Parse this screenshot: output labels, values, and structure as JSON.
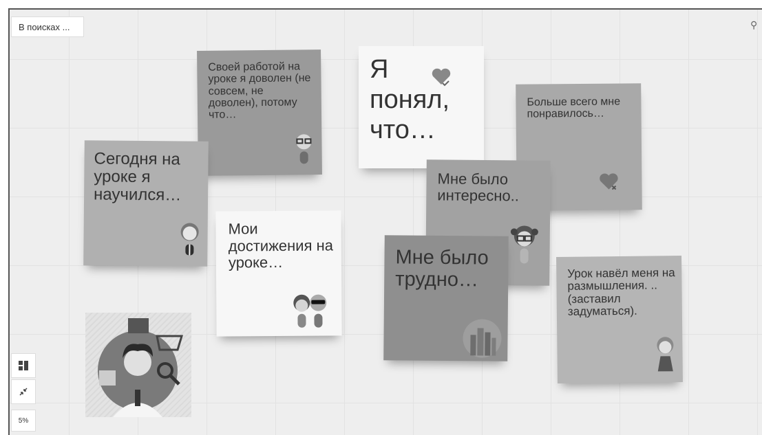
{
  "board": {
    "title_button": "В поисках ...",
    "zoom": "5%"
  },
  "icons": {
    "search": "search-icon",
    "layout": "layout-grid-icon",
    "collapse": "collapse-arrows-icon"
  },
  "notes": {
    "n1": {
      "text": "Своей работой на уроке я доволен (не совсем, не доволен), потому что…",
      "color": "#9a9a9a"
    },
    "n2": {
      "text": "Сегодня на уроке я научился…",
      "color": "#b0b0b0"
    },
    "n3": {
      "text": "Я понял, что…",
      "color": "#f7f7f7"
    },
    "n4": {
      "text": "Больше всего мне понравилось…",
      "color": "#a9a9a9"
    },
    "n5": {
      "text": "Мне было интересно..",
      "color": "#a2a2a2"
    },
    "n6": {
      "text": "Мои достижения на уроке…",
      "color": "#f7f7f7"
    },
    "n7": {
      "text": "Мне было трудно…",
      "color": "#8f8f8f"
    },
    "n8": {
      "text": "Урок навёл меня на размышления. ..(заставил задуматься).",
      "color": "#b5b5b5"
    }
  }
}
